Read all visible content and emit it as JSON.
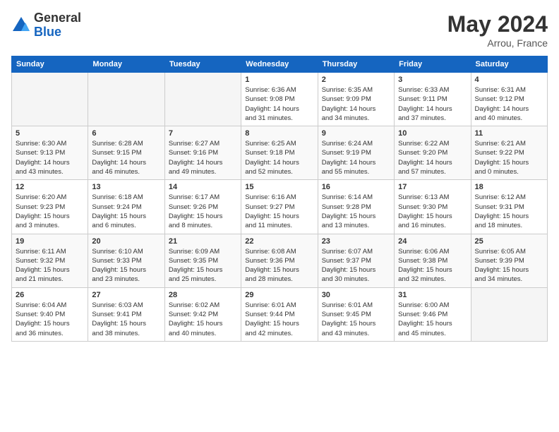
{
  "logo": {
    "general": "General",
    "blue": "Blue"
  },
  "header": {
    "month": "May 2024",
    "location": "Arrou, France"
  },
  "weekdays": [
    "Sunday",
    "Monday",
    "Tuesday",
    "Wednesday",
    "Thursday",
    "Friday",
    "Saturday"
  ],
  "weeks": [
    [
      {
        "day": "",
        "info": ""
      },
      {
        "day": "",
        "info": ""
      },
      {
        "day": "",
        "info": ""
      },
      {
        "day": "1",
        "info": "Sunrise: 6:36 AM\nSunset: 9:08 PM\nDaylight: 14 hours\nand 31 minutes."
      },
      {
        "day": "2",
        "info": "Sunrise: 6:35 AM\nSunset: 9:09 PM\nDaylight: 14 hours\nand 34 minutes."
      },
      {
        "day": "3",
        "info": "Sunrise: 6:33 AM\nSunset: 9:11 PM\nDaylight: 14 hours\nand 37 minutes."
      },
      {
        "day": "4",
        "info": "Sunrise: 6:31 AM\nSunset: 9:12 PM\nDaylight: 14 hours\nand 40 minutes."
      }
    ],
    [
      {
        "day": "5",
        "info": "Sunrise: 6:30 AM\nSunset: 9:13 PM\nDaylight: 14 hours\nand 43 minutes."
      },
      {
        "day": "6",
        "info": "Sunrise: 6:28 AM\nSunset: 9:15 PM\nDaylight: 14 hours\nand 46 minutes."
      },
      {
        "day": "7",
        "info": "Sunrise: 6:27 AM\nSunset: 9:16 PM\nDaylight: 14 hours\nand 49 minutes."
      },
      {
        "day": "8",
        "info": "Sunrise: 6:25 AM\nSunset: 9:18 PM\nDaylight: 14 hours\nand 52 minutes."
      },
      {
        "day": "9",
        "info": "Sunrise: 6:24 AM\nSunset: 9:19 PM\nDaylight: 14 hours\nand 55 minutes."
      },
      {
        "day": "10",
        "info": "Sunrise: 6:22 AM\nSunset: 9:20 PM\nDaylight: 14 hours\nand 57 minutes."
      },
      {
        "day": "11",
        "info": "Sunrise: 6:21 AM\nSunset: 9:22 PM\nDaylight: 15 hours\nand 0 minutes."
      }
    ],
    [
      {
        "day": "12",
        "info": "Sunrise: 6:20 AM\nSunset: 9:23 PM\nDaylight: 15 hours\nand 3 minutes."
      },
      {
        "day": "13",
        "info": "Sunrise: 6:18 AM\nSunset: 9:24 PM\nDaylight: 15 hours\nand 6 minutes."
      },
      {
        "day": "14",
        "info": "Sunrise: 6:17 AM\nSunset: 9:26 PM\nDaylight: 15 hours\nand 8 minutes."
      },
      {
        "day": "15",
        "info": "Sunrise: 6:16 AM\nSunset: 9:27 PM\nDaylight: 15 hours\nand 11 minutes."
      },
      {
        "day": "16",
        "info": "Sunrise: 6:14 AM\nSunset: 9:28 PM\nDaylight: 15 hours\nand 13 minutes."
      },
      {
        "day": "17",
        "info": "Sunrise: 6:13 AM\nSunset: 9:30 PM\nDaylight: 15 hours\nand 16 minutes."
      },
      {
        "day": "18",
        "info": "Sunrise: 6:12 AM\nSunset: 9:31 PM\nDaylight: 15 hours\nand 18 minutes."
      }
    ],
    [
      {
        "day": "19",
        "info": "Sunrise: 6:11 AM\nSunset: 9:32 PM\nDaylight: 15 hours\nand 21 minutes."
      },
      {
        "day": "20",
        "info": "Sunrise: 6:10 AM\nSunset: 9:33 PM\nDaylight: 15 hours\nand 23 minutes."
      },
      {
        "day": "21",
        "info": "Sunrise: 6:09 AM\nSunset: 9:35 PM\nDaylight: 15 hours\nand 25 minutes."
      },
      {
        "day": "22",
        "info": "Sunrise: 6:08 AM\nSunset: 9:36 PM\nDaylight: 15 hours\nand 28 minutes."
      },
      {
        "day": "23",
        "info": "Sunrise: 6:07 AM\nSunset: 9:37 PM\nDaylight: 15 hours\nand 30 minutes."
      },
      {
        "day": "24",
        "info": "Sunrise: 6:06 AM\nSunset: 9:38 PM\nDaylight: 15 hours\nand 32 minutes."
      },
      {
        "day": "25",
        "info": "Sunrise: 6:05 AM\nSunset: 9:39 PM\nDaylight: 15 hours\nand 34 minutes."
      }
    ],
    [
      {
        "day": "26",
        "info": "Sunrise: 6:04 AM\nSunset: 9:40 PM\nDaylight: 15 hours\nand 36 minutes."
      },
      {
        "day": "27",
        "info": "Sunrise: 6:03 AM\nSunset: 9:41 PM\nDaylight: 15 hours\nand 38 minutes."
      },
      {
        "day": "28",
        "info": "Sunrise: 6:02 AM\nSunset: 9:42 PM\nDaylight: 15 hours\nand 40 minutes."
      },
      {
        "day": "29",
        "info": "Sunrise: 6:01 AM\nSunset: 9:44 PM\nDaylight: 15 hours\nand 42 minutes."
      },
      {
        "day": "30",
        "info": "Sunrise: 6:01 AM\nSunset: 9:45 PM\nDaylight: 15 hours\nand 43 minutes."
      },
      {
        "day": "31",
        "info": "Sunrise: 6:00 AM\nSunset: 9:46 PM\nDaylight: 15 hours\nand 45 minutes."
      },
      {
        "day": "",
        "info": ""
      }
    ]
  ]
}
